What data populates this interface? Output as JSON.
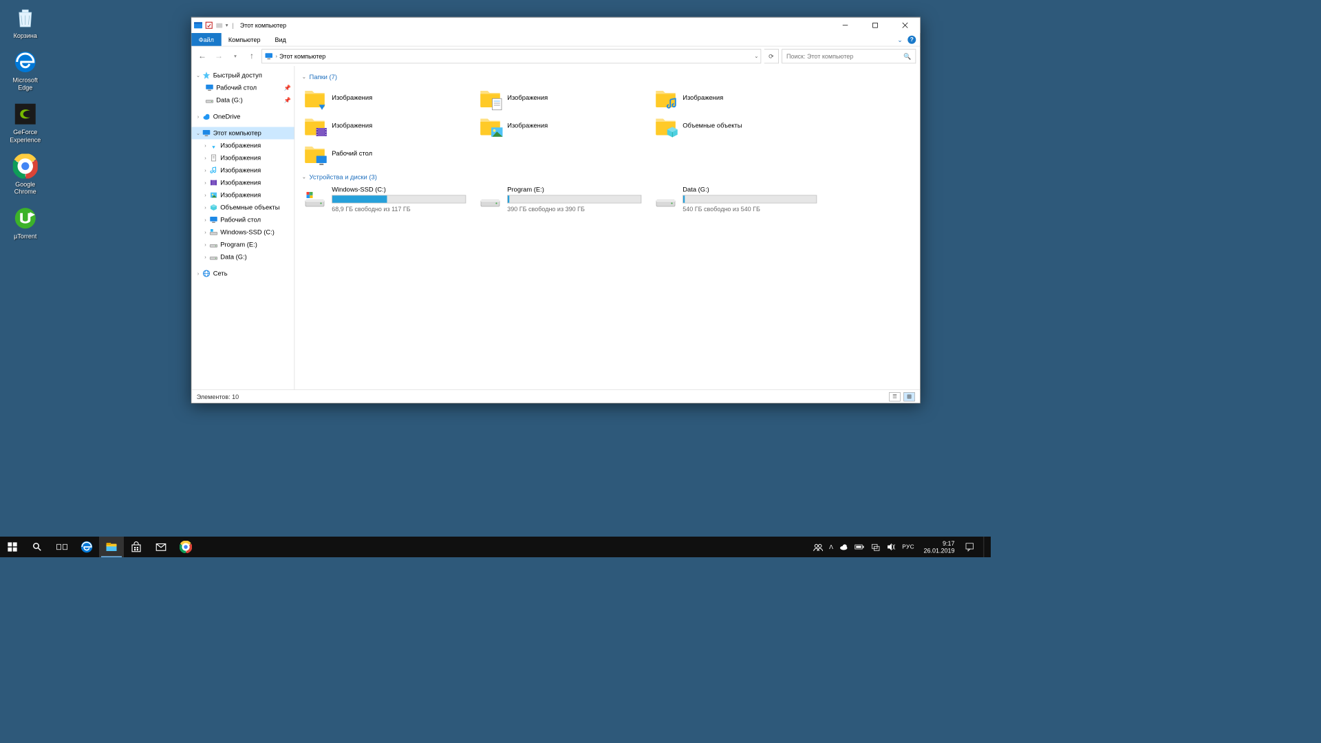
{
  "desktop": {
    "icons": [
      {
        "name": "Корзина",
        "kind": "recycle"
      },
      {
        "name": "Microsoft\nEdge",
        "kind": "edge"
      },
      {
        "name": "GeForce\nExperience",
        "kind": "nvidia"
      },
      {
        "name": "Google\nChrome",
        "kind": "chrome"
      },
      {
        "name": "µTorrent",
        "kind": "utorrent"
      }
    ]
  },
  "explorer": {
    "title": "Этот компьютер",
    "ribbon": {
      "file": "Файл",
      "computer": "Компьютер",
      "view": "Вид"
    },
    "address": {
      "root": "Этот компьютер"
    },
    "search_placeholder": "Поиск: Этот компьютер",
    "tree": {
      "quick_access": "Быстрый доступ",
      "quick_items": [
        {
          "label": "Рабочий стол",
          "icon": "desktop-small"
        },
        {
          "label": "Data (G:)",
          "icon": "drive-small"
        }
      ],
      "onedrive": "OneDrive",
      "this_pc": "Этот компьютер",
      "this_pc_items": [
        {
          "label": "Изображения",
          "icon": "dl"
        },
        {
          "label": "Изображения",
          "icon": "doc"
        },
        {
          "label": "Изображения",
          "icon": "music"
        },
        {
          "label": "Изображения",
          "icon": "video"
        },
        {
          "label": "Изображения",
          "icon": "pic"
        },
        {
          "label": "Объемные объекты",
          "icon": "3d"
        },
        {
          "label": "Рабочий стол",
          "icon": "desktop-small"
        },
        {
          "label": "Windows-SSD (C:)",
          "icon": "osdrive"
        },
        {
          "label": "Program (E:)",
          "icon": "drive-small"
        },
        {
          "label": "Data (G:)",
          "icon": "drive-small"
        }
      ],
      "network": "Сеть"
    },
    "content": {
      "folders_header": "Папки (7)",
      "folders": [
        {
          "label": "Изображения",
          "badge": "dl"
        },
        {
          "label": "Изображения",
          "badge": "doc"
        },
        {
          "label": "Изображения",
          "badge": "music"
        },
        {
          "label": "Изображения",
          "badge": "video"
        },
        {
          "label": "Изображения",
          "badge": "pic"
        },
        {
          "label": "Объемные объекты",
          "badge": "3d"
        },
        {
          "label": "Рабочий стол",
          "badge": "desk"
        }
      ],
      "drives_header": "Устройства и диски (3)",
      "drives": [
        {
          "name": "Windows-SSD (C:)",
          "sub": "68,9 ГБ свободно из 117 ГБ",
          "fill": 41,
          "os": true
        },
        {
          "name": "Program (E:)",
          "sub": "390 ГБ свободно из 390 ГБ",
          "fill": 1,
          "os": false
        },
        {
          "name": "Data (G:)",
          "sub": "540 ГБ свободно из 540 ГБ",
          "fill": 1,
          "os": false
        }
      ]
    },
    "status": "Элементов: 10"
  },
  "taskbar": {
    "time": "9:17",
    "date": "26.01.2019",
    "lang": "РУС"
  }
}
